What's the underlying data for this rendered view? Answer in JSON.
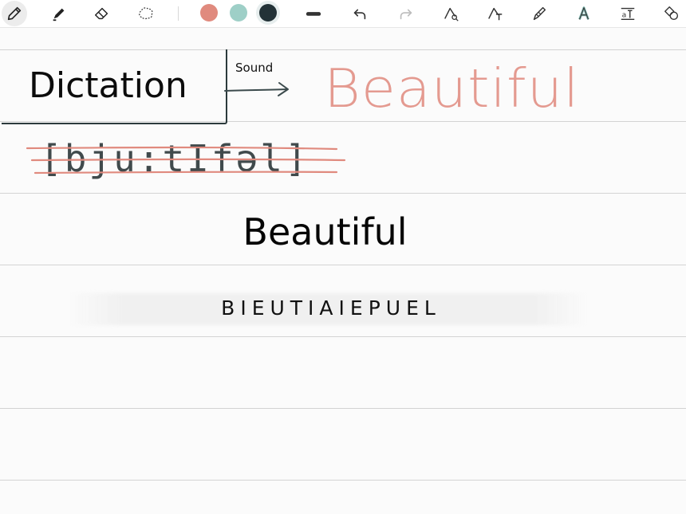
{
  "toolbar": {
    "tools": [
      {
        "name": "pen",
        "icon": "pen-icon",
        "active": true
      },
      {
        "name": "highlighter",
        "icon": "highlighter-icon",
        "active": false
      },
      {
        "name": "eraser",
        "icon": "eraser-icon",
        "active": false
      },
      {
        "name": "lasso",
        "icon": "lasso-icon",
        "active": false
      }
    ],
    "colors": [
      {
        "name": "salmon",
        "hex": "#e08a7e",
        "selected": false
      },
      {
        "name": "mint",
        "hex": "#9ecfc7",
        "selected": false
      },
      {
        "name": "dark-slate",
        "hex": "#233237",
        "selected": true
      }
    ],
    "actions": [
      {
        "name": "stroke-width",
        "icon": "stroke-width-icon"
      },
      {
        "name": "undo",
        "icon": "undo-icon"
      },
      {
        "name": "redo",
        "icon": "redo-icon"
      },
      {
        "name": "shape-search",
        "icon": "shape-search-icon"
      },
      {
        "name": "handwriting-to-text",
        "icon": "handwriting-to-text-icon"
      },
      {
        "name": "brush",
        "icon": "brush-icon"
      },
      {
        "name": "text-style",
        "icon": "text-style-icon"
      },
      {
        "name": "text-format",
        "icon": "text-format-icon"
      },
      {
        "name": "shapes",
        "icon": "shapes-icon"
      }
    ]
  },
  "content": {
    "dictation_title": "Dictation",
    "sound_label": "Sound",
    "handwritten_word": "Beautiful",
    "phonetic": "[bju:tIfəl]",
    "typed_word": "Beautiful",
    "guess_word": "BIEUTIAIEPUEL"
  },
  "colors": {
    "ink_dark": "#2c3a3c",
    "ink_salmon": "#e49a90",
    "rule_line": "#d3d3d3",
    "page_bg": "#fbfbfb"
  }
}
